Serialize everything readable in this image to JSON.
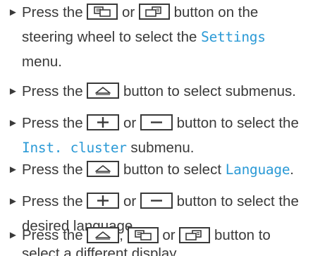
{
  "instructions": [
    {
      "lines": [
        [
          "Press the ",
          "{prev-display}",
          " or ",
          "{next-display}",
          " button on the"
        ],
        [
          "steering wheel to select the ",
          "[Settings]"
        ],
        [
          "menu."
        ]
      ]
    },
    {
      "lines": [
        [
          "Press the ",
          "{up-arrow}",
          " button to select submenus."
        ]
      ]
    },
    {
      "lines": [
        [
          "Press the ",
          "{plus}",
          " or ",
          "{minus}",
          " button to select the"
        ],
        [
          "[Inst. cluster]",
          " submenu."
        ]
      ]
    },
    {
      "lines": [
        [
          "Press the ",
          "{up-arrow}",
          " button to select ",
          "[Language]",
          "."
        ]
      ]
    },
    {
      "lines": [
        [
          "Press the ",
          "{plus}",
          " or ",
          "{minus}",
          " button to select the"
        ],
        [
          "desired language."
        ]
      ]
    },
    {
      "lines": [
        [
          "Press the ",
          "{up-arrow}",
          ", ",
          "{prev-display}",
          " or ",
          "{next-display}",
          " button to"
        ],
        [
          "select a different display."
        ]
      ]
    }
  ],
  "bullet_glyph": "►",
  "colors": {
    "text": "#3a3a3a",
    "menu_term": "#2b9ad6"
  }
}
